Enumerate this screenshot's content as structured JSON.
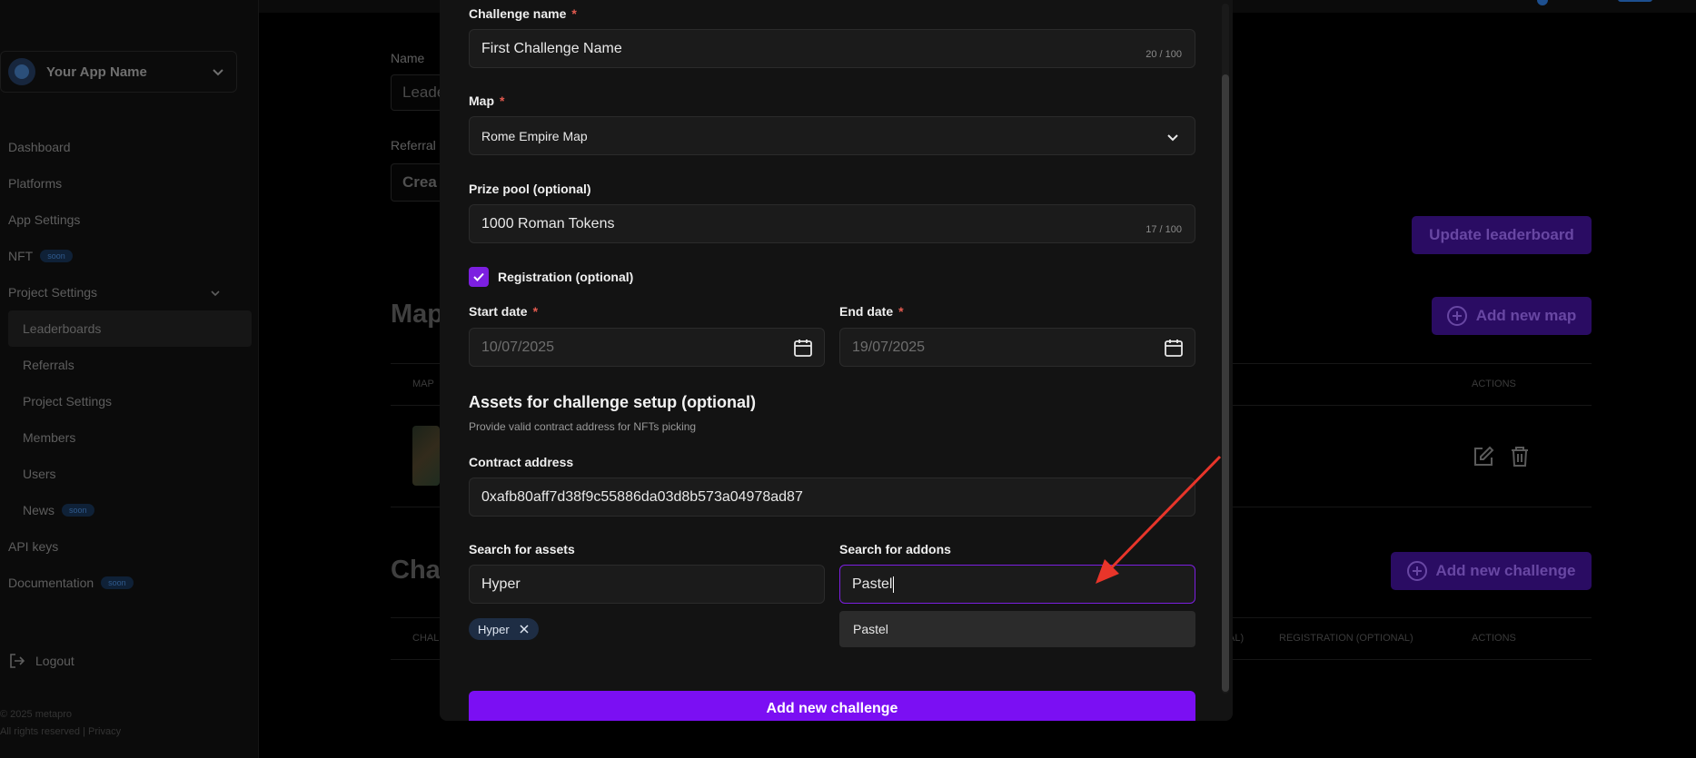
{
  "sidebar": {
    "app_name": "Your App Name",
    "items": [
      {
        "label": "Dashboard"
      },
      {
        "label": "Platforms"
      },
      {
        "label": "App Settings"
      },
      {
        "label": "NFT",
        "badge": "soon"
      },
      {
        "label": "Project Settings"
      },
      {
        "label": "Leaderboards"
      },
      {
        "label": "Referrals"
      },
      {
        "label": "Project Settings"
      },
      {
        "label": "Members"
      },
      {
        "label": "Users"
      },
      {
        "label": "News",
        "badge": "soon"
      },
      {
        "label": "API keys"
      },
      {
        "label": "Documentation",
        "badge": "soon"
      }
    ],
    "logout": "Logout",
    "footer_copyright": "© 2025 metapro",
    "footer_links": "All rights reserved | Privacy"
  },
  "background": {
    "name_label": "Name",
    "name_value": "Leade",
    "referral_label": "Referral",
    "create_btn": "Crea",
    "update_btn": "Update leaderboard",
    "maps_heading": "Map",
    "add_map_btn": "Add new map",
    "map_col": "MAP",
    "actions_col": "ACTIONS",
    "challenges_heading": "Cha",
    "add_challenge_btn": "Add new challenge",
    "chal_col": "CHAL",
    "optional_col": "AL)",
    "registration_col": "REGISTRATION (OPTIONAL)",
    "actions_col2": "ACTIONS"
  },
  "modal": {
    "challenge_name": {
      "label": "Challenge name",
      "value": "First Challenge Name",
      "counter": "20 / 100"
    },
    "map": {
      "label": "Map",
      "value": "Rome Empire Map"
    },
    "prize_pool": {
      "label": "Prize pool (optional)",
      "value": "1000 Roman Tokens",
      "counter": "17 / 100"
    },
    "registration": {
      "label": "Registration (optional)",
      "checked": true
    },
    "start_date": {
      "label": "Start date",
      "placeholder": "10/07/2025"
    },
    "end_date": {
      "label": "End date",
      "placeholder": "19/07/2025"
    },
    "assets_title": "Assets for challenge setup (optional)",
    "assets_subtitle": "Provide valid contract address for NFTs picking",
    "contract": {
      "label": "Contract address",
      "value": "0xafb80aff7d38f9c55886da03d8b573a04978ad87"
    },
    "search_assets": {
      "label": "Search for assets",
      "value": "Hyper",
      "chip": "Hyper"
    },
    "search_addons": {
      "label": "Search for addons",
      "value": "Pastel",
      "option": "Pastel"
    },
    "required_mark": "*",
    "submit": "Add new challenge"
  },
  "colors": {
    "accent": "#7b0ff3",
    "annotation_arrow": "#e8352a"
  }
}
